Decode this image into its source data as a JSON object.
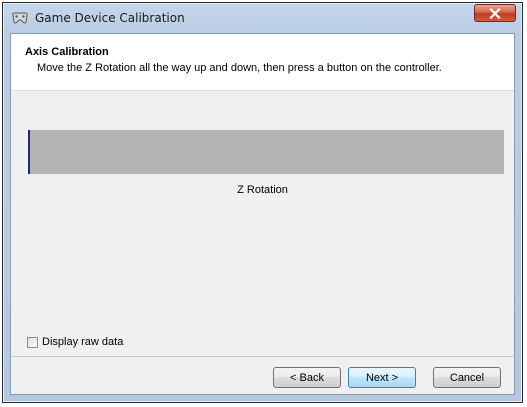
{
  "window": {
    "title": "Game Device Calibration",
    "close_icon": "close-icon",
    "app_icon": "gamepad-icon"
  },
  "header": {
    "title": "Axis Calibration",
    "subtitle": "Move the Z Rotation all the way up and down, then press a button on the controller."
  },
  "axis": {
    "label": "Z Rotation",
    "position_fraction": 0.0
  },
  "options": {
    "raw_data_label": "Display raw data",
    "raw_data_checked": false
  },
  "buttons": {
    "back": "< Back",
    "next": "Next >",
    "cancel": "Cancel"
  },
  "colors": {
    "axis_bar": "#b4b4b4",
    "axis_marker": "#1c2f6b",
    "close_button": "#c2391d"
  }
}
